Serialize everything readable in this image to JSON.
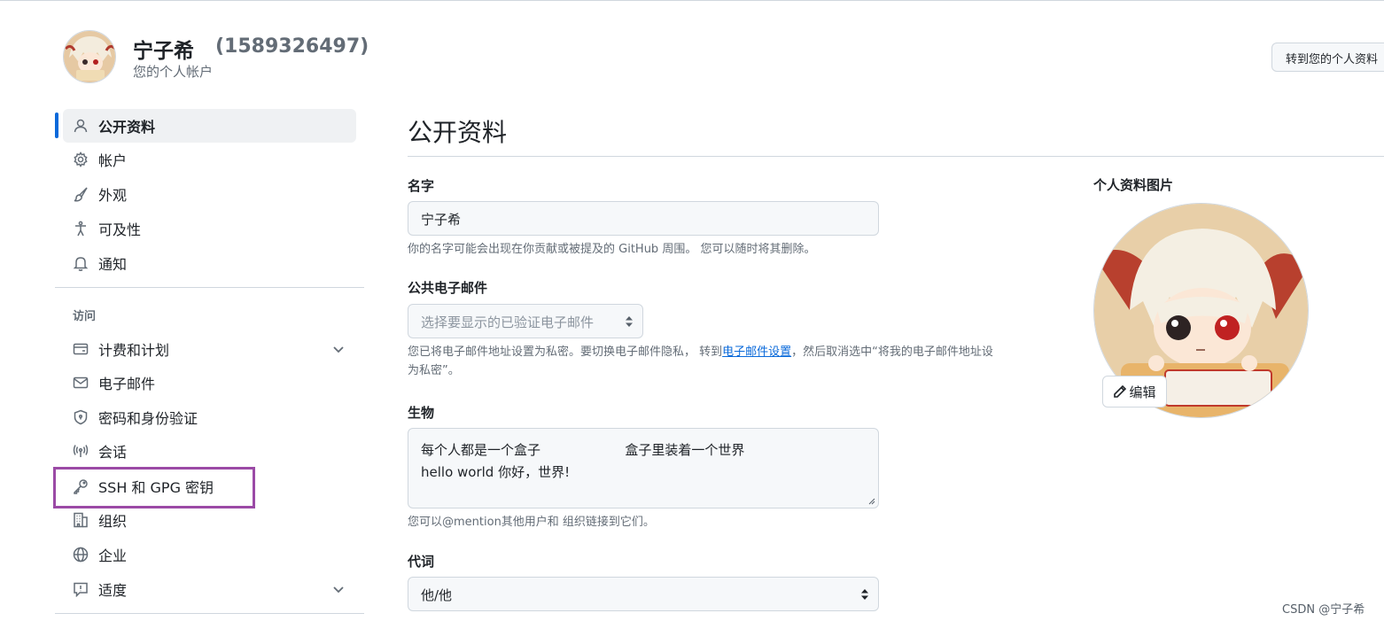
{
  "header": {
    "name": "宁子希",
    "login": "(1589326497)",
    "subtitle": "您的个人帐户",
    "go_profile_button": "转到您的个人资料"
  },
  "sidebar": {
    "items": [
      {
        "label": "公开资料",
        "icon": "person-icon",
        "active": true
      },
      {
        "label": "帐户",
        "icon": "gear-icon"
      },
      {
        "label": "外观",
        "icon": "paintbrush-icon"
      },
      {
        "label": "可及性",
        "icon": "accessibility-icon"
      },
      {
        "label": "通知",
        "icon": "bell-icon"
      }
    ],
    "access_label": "访问",
    "access_items": [
      {
        "label": "计费和计划",
        "icon": "credit-card-icon",
        "expandable": true
      },
      {
        "label": "电子邮件",
        "icon": "mail-icon"
      },
      {
        "label": "密码和身份验证",
        "icon": "shield-icon"
      },
      {
        "label": "会话",
        "icon": "broadcast-icon"
      },
      {
        "label": "SSH 和 GPG 密钥",
        "icon": "key-icon",
        "highlighted": true
      },
      {
        "label": "组织",
        "icon": "organization-icon"
      },
      {
        "label": "企业",
        "icon": "globe-icon"
      },
      {
        "label": "适度",
        "icon": "report-icon",
        "expandable": true
      }
    ]
  },
  "main": {
    "title": "公开资料",
    "name_field": {
      "label": "名字",
      "value": "宁子希",
      "note": "你的名字可能会出现在你贡献或被提及的 GitHub 周围。 您可以随时将其删除。"
    },
    "email_field": {
      "label": "公共电子邮件",
      "placeholder": "选择要显示的已验证电子邮件",
      "note_before_link": "您已将电子邮件地址设置为私密。要切换电子邮件隐私， 转到",
      "note_link": "电子邮件设置",
      "note_after_link_line1": "，然后取消选中“将我的电子邮件地址设",
      "note_line2": "为私密”。"
    },
    "bio_field": {
      "label": "生物",
      "line1": "每个人都是一个盒子                    盒子里装着一个世界",
      "line2": "hello world 你好，世界!",
      "note": "您可以@mention其他用户和 组织链接到它们。"
    },
    "pronoun_field": {
      "label": "代词",
      "value": "他/他"
    }
  },
  "profile_picture": {
    "label": "个人资料图片",
    "edit_button": "编辑"
  },
  "watermark": "CSDN @宁子希",
  "colors": {
    "accent": "#0969da",
    "highlight_border": "#9b4aa6",
    "input_bg": "#f6f8fa",
    "border": "#d0d7de"
  }
}
